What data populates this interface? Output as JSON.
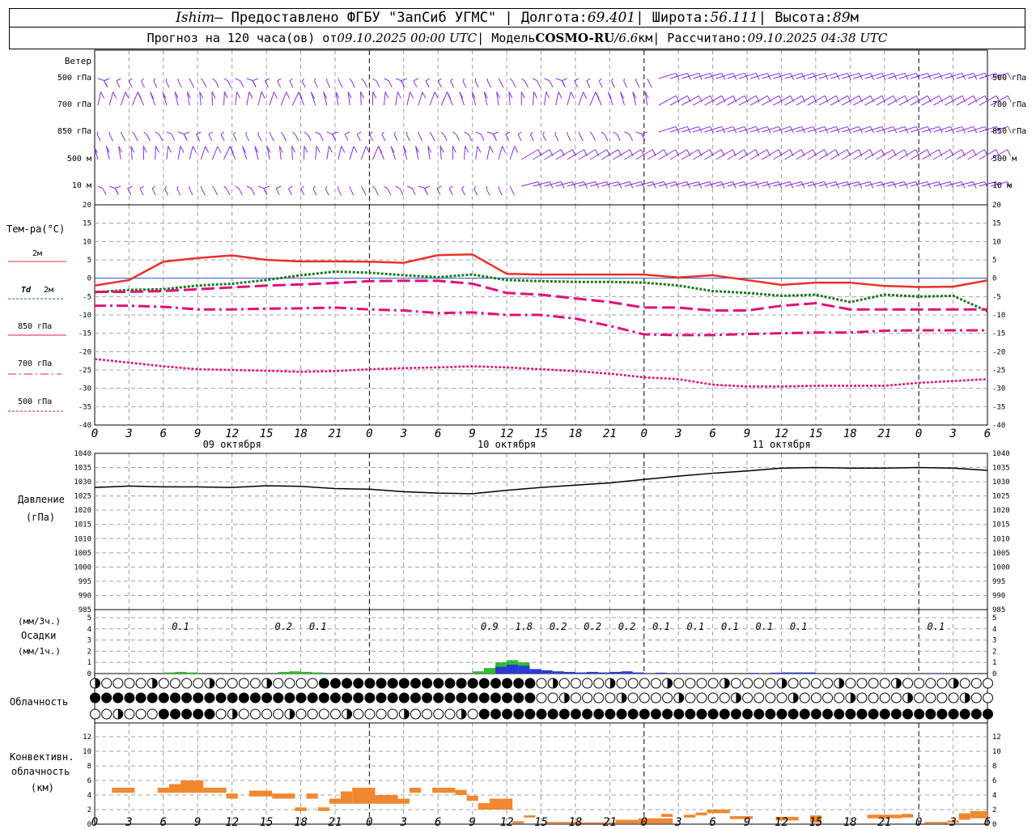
{
  "header": {
    "station": "Ishim",
    "provider_prefix": "– Предоставлено ФГБУ \"ЗапСиб УГМС\" | Долгота:",
    "lon": "69.401",
    "lat_label": "| Широта:",
    "lat": "56.111",
    "alt_label": "| Высота:",
    "alt": "89",
    "alt_unit": "м",
    "forecast_prefix": "Прогноз на 120 часа(ов) от",
    "forecast_start": "09.10.2025 00:00 UTC",
    "model_label": "| Модель",
    "model_name": "COSMO-RU",
    "model_sep": "/",
    "model_res": "6.6",
    "model_res_unit": "км",
    "computed_label": "| Рассчитано:",
    "computed_time": "09.10.2025 04:38 UTC"
  },
  "colors": {
    "grid": "#a0a0a0",
    "wind": "#8a2be2",
    "t2m": "#e8312a",
    "td2m": "#1a7a1a",
    "t850": "#e0107a",
    "t700": "#e0107a",
    "t500": "#e0107a",
    "pressure": "#000000",
    "precip_green": "#2dbd2d",
    "precip_blue": "#2a3ad8",
    "convective": "#f08830",
    "zero_line": "#3060d0"
  },
  "labels": {
    "wind_title": "Ветер",
    "wind_levels": [
      "500 гПа",
      "700 гПа",
      "850 гПа",
      "500 м",
      "10 м"
    ],
    "temp_title": "Тем-ра(°C)",
    "legend_t2m": "2м",
    "legend_td": "Td",
    "legend_td_level": "2м",
    "legend_850": "850 гПа",
    "legend_700": "700 гПа",
    "legend_500": "500 гПа",
    "pressure_title": "Давление",
    "pressure_unit": "(гПа)",
    "precip_unit3": "(мм/3ч.)",
    "precip_title": "Осадки",
    "precip_unit1": "(мм/1ч.)",
    "cloud_title": "Облачность",
    "conv_title1": "Конвективн.",
    "conv_title2": "облачность",
    "conv_unit": "(км)",
    "dates": [
      "09 октября",
      "10 октября",
      "11 октября"
    ]
  },
  "chart_data": [
    {
      "type": "wind_barbs",
      "levels": [
        "500 гПа",
        "700 гПа",
        "850 гПа",
        "500 м",
        "10 м"
      ],
      "x_hours_range": [
        0,
        78
      ]
    },
    {
      "type": "line",
      "title": "",
      "xlabel": "",
      "ylabel": "Тем-ра(°C)",
      "x_ticks": [
        0,
        3,
        6,
        9,
        12,
        15,
        18,
        21,
        0,
        3,
        6,
        9,
        12,
        15,
        18,
        21,
        0,
        3,
        6,
        9,
        12,
        15,
        18,
        21,
        0,
        3,
        6
      ],
      "ylim": [
        -40,
        20
      ],
      "y_ticks": [
        20,
        15,
        10,
        5,
        0,
        -5,
        -10,
        -15,
        -20,
        -25,
        -30,
        -35,
        -40
      ],
      "series": [
        {
          "name": "2м",
          "style": "solid",
          "x": [
            0,
            3,
            6,
            9,
            12,
            15,
            18,
            21,
            24,
            27,
            30,
            33,
            36,
            39,
            42,
            45,
            48,
            51,
            54,
            57,
            60,
            63,
            66,
            69,
            72,
            75,
            78
          ],
          "y": [
            -2,
            -0.5,
            4.5,
            5.5,
            6.2,
            5,
            4.6,
            4.6,
            4.5,
            4.2,
            6.3,
            6.5,
            1.2,
            1,
            1,
            1,
            1,
            0.2,
            0.8,
            -0.5,
            -1.8,
            -1.2,
            -1.2,
            -2.1,
            -2.4,
            -2.3,
            -0.6
          ]
        },
        {
          "name": "Td 2м",
          "style": "dotted",
          "x": [
            0,
            3,
            6,
            9,
            12,
            15,
            18,
            21,
            24,
            27,
            30,
            33,
            36,
            39,
            42,
            45,
            48,
            51,
            54,
            57,
            60,
            63,
            66,
            69,
            72,
            75,
            78
          ],
          "y": [
            -3.8,
            -3.2,
            -3,
            -2,
            -1.5,
            -0.5,
            0.8,
            1.8,
            1.5,
            0.8,
            0.3,
            1,
            -0.5,
            -0.8,
            -1,
            -1,
            -1.2,
            -2,
            -3.5,
            -4,
            -4.8,
            -4.5,
            -6.5,
            -4.5,
            -5,
            -4.8,
            -9
          ]
        },
        {
          "name": "850 гПа",
          "style": "dashed",
          "x": [
            0,
            3,
            6,
            9,
            12,
            15,
            18,
            21,
            24,
            27,
            30,
            33,
            36,
            39,
            42,
            45,
            48,
            51,
            54,
            57,
            60,
            63,
            66,
            69,
            72,
            75,
            78
          ],
          "y": [
            -3.7,
            -3.7,
            -3.5,
            -3,
            -2.5,
            -2,
            -1.7,
            -1.3,
            -0.8,
            -0.7,
            -0.7,
            -1.5,
            -4,
            -4.5,
            -5.5,
            -6.5,
            -8,
            -8,
            -8.8,
            -8.8,
            -7.5,
            -6.8,
            -8.5,
            -8.5,
            -8.5,
            -8.5,
            -8.5
          ]
        },
        {
          "name": "700 гПа",
          "style": "dashdot",
          "x": [
            0,
            3,
            6,
            9,
            12,
            15,
            18,
            21,
            24,
            27,
            30,
            33,
            36,
            39,
            42,
            45,
            48,
            51,
            54,
            57,
            60,
            63,
            66,
            69,
            72,
            75,
            78
          ],
          "y": [
            -7.5,
            -7.5,
            -7.8,
            -8.5,
            -8.5,
            -8.3,
            -8.2,
            -8,
            -8.5,
            -8.8,
            -9.5,
            -9.3,
            -10,
            -10,
            -11,
            -13,
            -15.3,
            -15.5,
            -15.5,
            -15.2,
            -15,
            -14.8,
            -14.8,
            -14.3,
            -14.2,
            -14.2,
            -14.2
          ]
        },
        {
          "name": "500 гПа",
          "style": "dotted",
          "x": [
            0,
            3,
            6,
            9,
            12,
            15,
            18,
            21,
            24,
            27,
            30,
            33,
            36,
            39,
            42,
            45,
            48,
            51,
            54,
            57,
            60,
            63,
            66,
            69,
            72,
            75,
            78
          ],
          "y": [
            -22,
            -23,
            -24,
            -24.8,
            -25,
            -25.2,
            -25.5,
            -25.3,
            -24.8,
            -24.5,
            -24.3,
            -24,
            -24.3,
            -24.8,
            -25.3,
            -26,
            -27,
            -27.5,
            -29,
            -29.5,
            -29.5,
            -29.3,
            -29.3,
            -29.3,
            -28.5,
            -28,
            -27.5
          ]
        }
      ]
    },
    {
      "type": "line",
      "title": "",
      "xlabel": "",
      "ylabel": "Давление (гПа)",
      "ylim": [
        985,
        1040
      ],
      "y_ticks": [
        1040,
        1035,
        1030,
        1025,
        1020,
        1015,
        1010,
        1005,
        1000,
        995,
        990,
        985
      ],
      "series": [
        {
          "name": "",
          "x": [
            0,
            3,
            6,
            9,
            12,
            15,
            18,
            21,
            24,
            27,
            30,
            33,
            36,
            39,
            42,
            45,
            48,
            51,
            54,
            57,
            60,
            63,
            66,
            69,
            72,
            75,
            78
          ],
          "y": [
            1028,
            1028.5,
            1028.2,
            1028.2,
            1028,
            1028.6,
            1028.4,
            1027.6,
            1027.4,
            1026.5,
            1026,
            1025.8,
            1027,
            1028,
            1028.8,
            1029.6,
            1030.8,
            1032,
            1033,
            1033.8,
            1034.8,
            1035,
            1034.8,
            1034.8,
            1035,
            1034.8,
            1034
          ]
        }
      ]
    },
    {
      "type": "bar",
      "ylabel": "Осадки",
      "ylim": [
        0,
        5
      ],
      "y_ticks": [
        5,
        4,
        3,
        2,
        1,
        0
      ],
      "precip_3h_labels": [
        {
          "h": 7.5,
          "v": "0.1"
        },
        {
          "h": 16.5,
          "v": "0.2"
        },
        {
          "h": 19.5,
          "v": "0.1"
        },
        {
          "h": 34.5,
          "v": "0.9"
        },
        {
          "h": 37.5,
          "v": "1.8"
        },
        {
          "h": 40.5,
          "v": "0.2"
        },
        {
          "h": 43.5,
          "v": "0.2"
        },
        {
          "h": 46.5,
          "v": "0.2"
        },
        {
          "h": 49.5,
          "v": "0.1"
        },
        {
          "h": 52.5,
          "v": "0.1"
        },
        {
          "h": 55.5,
          "v": "0.1"
        },
        {
          "h": 58.5,
          "v": "0.1"
        },
        {
          "h": 61.5,
          "v": "0.1"
        },
        {
          "h": 73.5,
          "v": "0.1"
        }
      ],
      "hourly_green": [
        {
          "h": 6,
          "v": 0.1
        },
        {
          "h": 7,
          "v": 0.15
        },
        {
          "h": 8,
          "v": 0.1
        },
        {
          "h": 16,
          "v": 0.15
        },
        {
          "h": 17,
          "v": 0.2
        },
        {
          "h": 18,
          "v": 0.15
        },
        {
          "h": 19,
          "v": 0.1
        },
        {
          "h": 33,
          "v": 0.2
        },
        {
          "h": 34,
          "v": 0.5
        },
        {
          "h": 35,
          "v": 1.0
        },
        {
          "h": 36,
          "v": 1.2
        },
        {
          "h": 37,
          "v": 1.0
        }
      ],
      "hourly_blue": [
        {
          "h": 35,
          "v": 0.6
        },
        {
          "h": 36,
          "v": 0.8
        },
        {
          "h": 37,
          "v": 0.7
        },
        {
          "h": 38,
          "v": 0.4
        },
        {
          "h": 39,
          "v": 0.3
        },
        {
          "h": 40,
          "v": 0.2
        },
        {
          "h": 41,
          "v": 0.15
        },
        {
          "h": 42,
          "v": 0.1
        },
        {
          "h": 43,
          "v": 0.15
        },
        {
          "h": 44,
          "v": 0.1
        },
        {
          "h": 45,
          "v": 0.15
        },
        {
          "h": 46,
          "v": 0.2
        },
        {
          "h": 47,
          "v": 0.1
        },
        {
          "h": 49,
          "v": 0.08
        },
        {
          "h": 51,
          "v": 0.05
        },
        {
          "h": 57,
          "v": 0.06
        },
        {
          "h": 59,
          "v": 0.08
        },
        {
          "h": 60,
          "v": 0.1
        },
        {
          "h": 61,
          "v": 0.1
        },
        {
          "h": 62,
          "v": 0.1
        },
        {
          "h": 73,
          "v": 0.05
        }
      ]
    },
    {
      "type": "cloud_cover",
      "rows": 3,
      "row_hint": [
        "low",
        "mid",
        "high"
      ]
    },
    {
      "type": "bar",
      "ylabel": "Конвективн. облачность (км)",
      "ylim": [
        0,
        13
      ],
      "y_ticks": [
        12,
        10,
        8,
        6,
        4,
        2,
        0
      ],
      "segments": [
        {
          "h0": 1.5,
          "h1": 3.5,
          "bottom": 4.3,
          "top": 5.0
        },
        {
          "h0": 5.5,
          "h1": 6.5,
          "bottom": 4.3,
          "top": 5.0
        },
        {
          "h0": 6.5,
          "h1": 7.5,
          "bottom": 4.3,
          "top": 5.5
        },
        {
          "h0": 7.5,
          "h1": 9.5,
          "bottom": 4.3,
          "top": 6.0
        },
        {
          "h0": 9.5,
          "h1": 11.5,
          "bottom": 4.3,
          "top": 5.0
        },
        {
          "h0": 11.5,
          "h1": 12.5,
          "bottom": 3.5,
          "top": 4.2
        },
        {
          "h0": 13.5,
          "h1": 15.5,
          "bottom": 3.8,
          "top": 4.6
        },
        {
          "h0": 15.5,
          "h1": 17.5,
          "bottom": 3.5,
          "top": 4.2
        },
        {
          "h0": 18.5,
          "h1": 19.5,
          "bottom": 3.5,
          "top": 4.2
        },
        {
          "h0": 17.5,
          "h1": 18.5,
          "bottom": 1.8,
          "top": 2.3
        },
        {
          "h0": 19.5,
          "h1": 20.5,
          "bottom": 1.8,
          "top": 2.3
        },
        {
          "h0": 20.5,
          "h1": 21.5,
          "bottom": 2.8,
          "top": 3.5
        },
        {
          "h0": 21.5,
          "h1": 22.5,
          "bottom": 2.8,
          "top": 4.5
        },
        {
          "h0": 22.5,
          "h1": 24.5,
          "bottom": 2.8,
          "top": 5.0
        },
        {
          "h0": 24.5,
          "h1": 26.5,
          "bottom": 2.8,
          "top": 4.0
        },
        {
          "h0": 26.5,
          "h1": 27.5,
          "bottom": 2.8,
          "top": 3.5
        },
        {
          "h0": 27.5,
          "h1": 28.5,
          "bottom": 4.3,
          "top": 5.0
        },
        {
          "h0": 29.5,
          "h1": 31.5,
          "bottom": 4.3,
          "top": 5.0
        },
        {
          "h0": 31.5,
          "h1": 32.5,
          "bottom": 4.0,
          "top": 4.7
        },
        {
          "h0": 32.5,
          "h1": 33.5,
          "bottom": 3.2,
          "top": 3.9
        },
        {
          "h0": 33.5,
          "h1": 34.5,
          "bottom": 2.0,
          "top": 2.9
        },
        {
          "h0": 34.5,
          "h1": 36.5,
          "bottom": 2.0,
          "top": 3.5
        },
        {
          "h0": 36.5,
          "h1": 37.5,
          "bottom": 0.1,
          "top": 0.4
        },
        {
          "h0": 37.5,
          "h1": 38.5,
          "bottom": 0.9,
          "top": 1.2
        },
        {
          "h0": 39.5,
          "h1": 42.5,
          "bottom": 0.1,
          "top": 0.3
        },
        {
          "h0": 42.5,
          "h1": 45.5,
          "bottom": 0.1,
          "top": 0.25
        },
        {
          "h0": 45.5,
          "h1": 47.5,
          "bottom": 0.1,
          "top": 0.6
        },
        {
          "h0": 47.5,
          "h1": 50.5,
          "bottom": 0.1,
          "top": 0.8
        },
        {
          "h0": 49.5,
          "h1": 50.5,
          "bottom": 1.0,
          "top": 1.4
        },
        {
          "h0": 51.5,
          "h1": 52.5,
          "bottom": 0.9,
          "top": 1.3
        },
        {
          "h0": 52.5,
          "h1": 53.5,
          "bottom": 1.2,
          "top": 1.6
        },
        {
          "h0": 53.5,
          "h1": 55.5,
          "bottom": 1.5,
          "top": 2.0
        },
        {
          "h0": 55.5,
          "h1": 57.5,
          "bottom": 0.7,
          "top": 1.1
        },
        {
          "h0": 59.5,
          "h1": 61.5,
          "bottom": 0.5,
          "top": 1.0
        },
        {
          "h0": 62.5,
          "h1": 63.5,
          "bottom": 0.2,
          "top": 1.2
        },
        {
          "h0": 67.5,
          "h1": 70.5,
          "bottom": 0.8,
          "top": 1.3
        },
        {
          "h0": 70.5,
          "h1": 71.5,
          "bottom": 0.9,
          "top": 1.4
        },
        {
          "h0": 72.5,
          "h1": 74.5,
          "bottom": 0.1,
          "top": 0.3
        },
        {
          "h0": 74.5,
          "h1": 75.5,
          "bottom": 0.2,
          "top": 0.5
        },
        {
          "h0": 75.5,
          "h1": 76.5,
          "bottom": 0.6,
          "top": 1.5
        },
        {
          "h0": 76.5,
          "h1": 78,
          "bottom": 0.8,
          "top": 1.8
        }
      ]
    }
  ]
}
